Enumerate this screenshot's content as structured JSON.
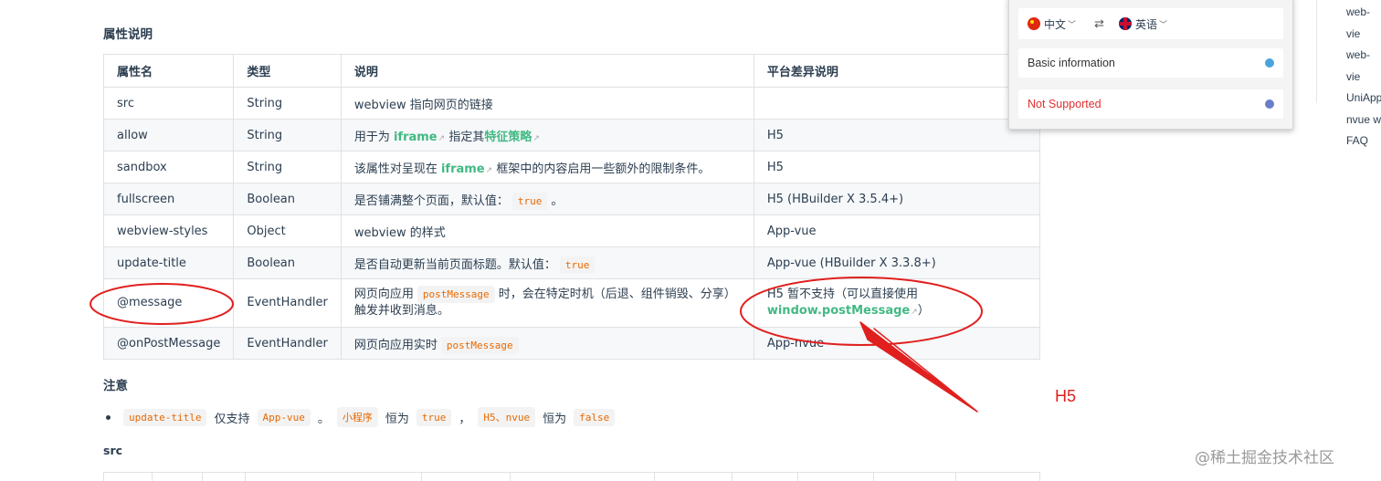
{
  "section_props_title": "属性说明",
  "table": {
    "headers": [
      "属性名",
      "类型",
      "说明",
      "平台差异说明"
    ],
    "rows": [
      {
        "name": "src",
        "type": "String",
        "desc": "webview 指向网页的链接",
        "platform": ""
      },
      {
        "name": "allow",
        "type": "String",
        "desc_pre": "用于为",
        "desc_link1": "iframe",
        "desc_mid": "指定其",
        "desc_link2": "特征策略",
        "platform": "H5"
      },
      {
        "name": "sandbox",
        "type": "String",
        "desc_pre": "该属性对呈现在",
        "desc_link1": "iframe",
        "desc_post": "框架中的内容启用一些额外的限制条件。",
        "platform": "H5"
      },
      {
        "name": "fullscreen",
        "type": "Boolean",
        "desc_pre": "是否铺满整个页面，默认值：",
        "desc_code": "true",
        "desc_post": "。",
        "platform": "H5 (HBuilder X 3.5.4+)"
      },
      {
        "name": "webview-styles",
        "type": "Object",
        "desc": "webview 的样式",
        "platform": "App-vue"
      },
      {
        "name": "update-title",
        "type": "Boolean",
        "desc_pre": "是否自动更新当前页面标题。默认值：",
        "desc_code": "true",
        "platform": "App-vue (HBuilder X 3.3.8+)"
      },
      {
        "name": "@message",
        "type": "EventHandler",
        "desc_pre": "网页向应用",
        "desc_code": "postMessage",
        "desc_post": "时，会在特定时机（后退、组件销毁、分享）触发并收到消息。",
        "platform_pre": "H5 暂不支持（可以直接使用",
        "platform_link": "window.postMessage",
        "platform_post": "）"
      },
      {
        "name": "@onPostMessage",
        "type": "EventHandler",
        "desc_pre": "网页向应用实时",
        "desc_code": "postMessage",
        "platform": "App-nvue"
      }
    ]
  },
  "note": {
    "title": "注意",
    "code1": "update-title",
    "t1": "仅支持",
    "code2": "App-vue",
    "t2": "。",
    "code3": "小程序",
    "t3": "恒为",
    "code4": "true",
    "t4": "，",
    "code5": "H5、nvue",
    "t5": "恒为",
    "code6": "false"
  },
  "section_src_title": "src",
  "popup": {
    "lang_from": "中文",
    "lang_to": "英语",
    "swap_icon": "⇄",
    "basic_info": "Basic information",
    "not_supported": "Not Supported"
  },
  "right_nav": [
    "web-vie",
    "web-vie",
    "UniApp",
    "nvue w",
    "FAQ"
  ],
  "annotation_label": "H5",
  "watermark": "@稀土掘金技术社区",
  "colors": {
    "link": "#42b983",
    "code": "#e96900",
    "annotation": "#e0201e"
  }
}
